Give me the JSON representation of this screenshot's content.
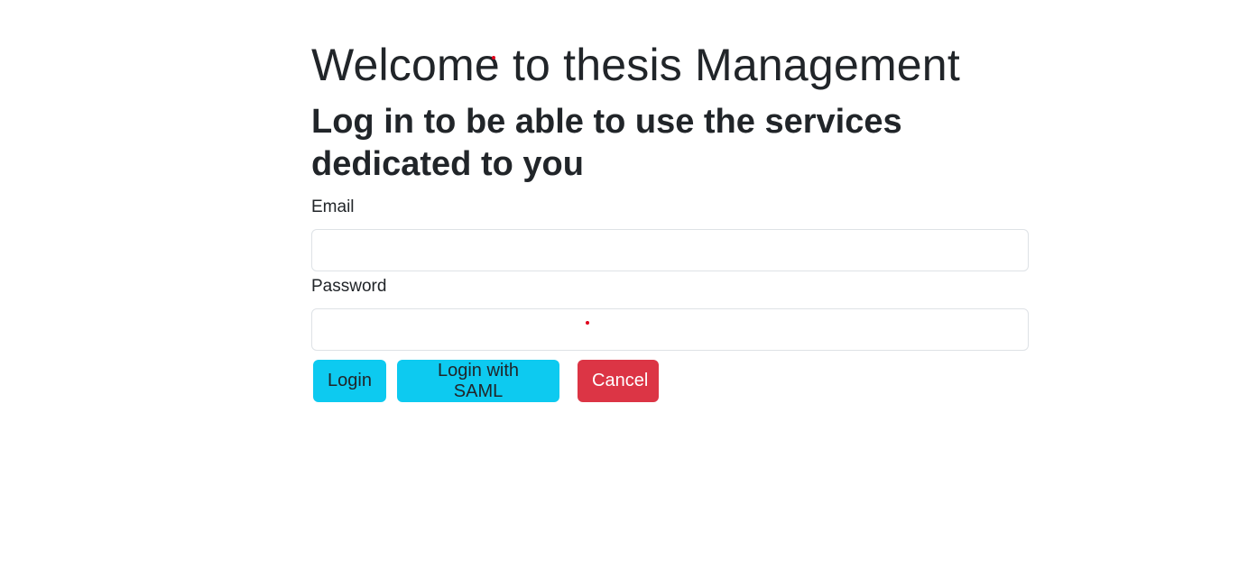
{
  "heading": {
    "title": "Welcome to thesis Management",
    "subtitle": "Log in to be able to use the services dedicated to you"
  },
  "form": {
    "email_label": "Email",
    "email_value": "",
    "password_label": "Password",
    "password_value": ""
  },
  "buttons": {
    "login": "Login",
    "login_saml": "Login with SAML",
    "cancel": "Cancel"
  },
  "colors": {
    "info": "#0dcaf0",
    "danger": "#dc3545",
    "text": "#212529",
    "input_border": "#dee2e6"
  }
}
